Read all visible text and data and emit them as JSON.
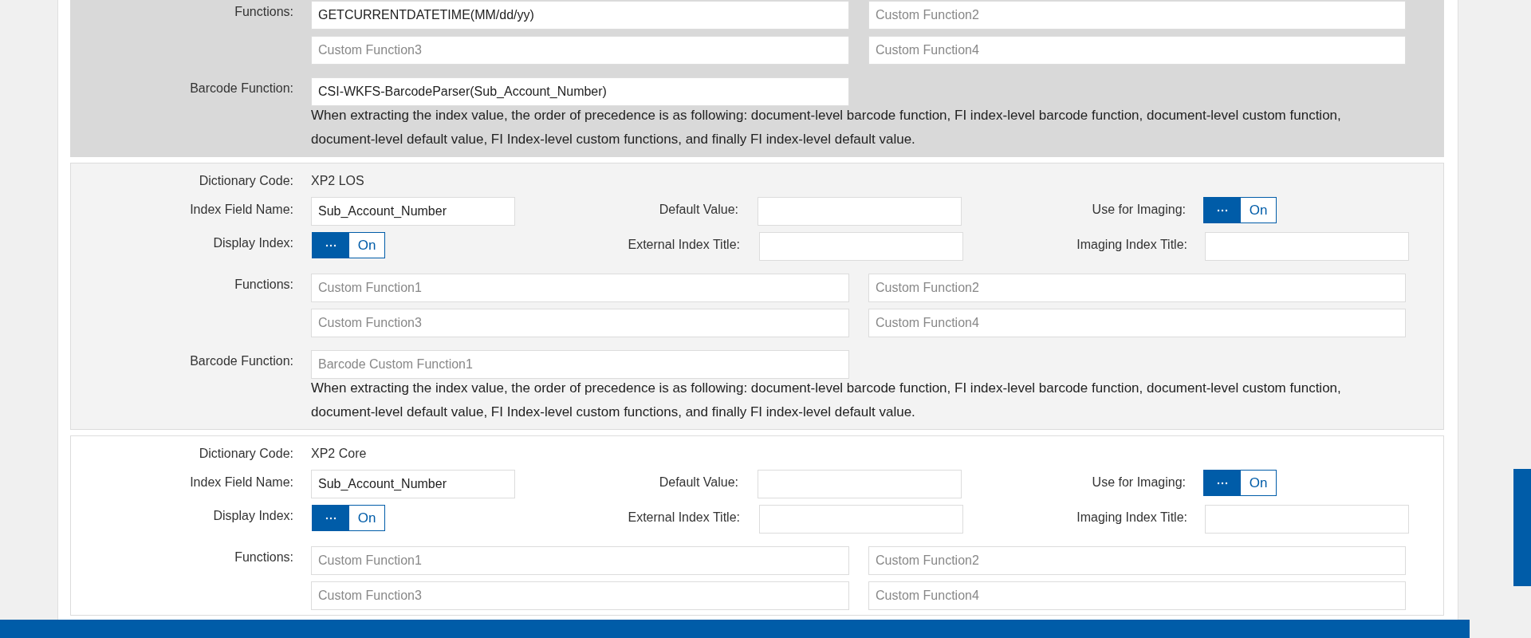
{
  "sections": [
    {
      "selected": true,
      "hovered": false,
      "functions_label": "Functions:",
      "functions": [
        {
          "value": "GETCURRENTDATETIME(MM/dd/yy)"
        },
        {
          "placeholder": "Custom Function2"
        },
        {
          "placeholder": "Custom Function3"
        },
        {
          "placeholder": "Custom Function4"
        }
      ],
      "barcode_label": "Barcode Function:",
      "barcode": {
        "value": "CSI-WKFS-BarcodeParser(Sub_Account_Number)"
      },
      "note": "When extracting the index value, the order of precedence is as following: document-level barcode function, FI index-level barcode function, document-level custom function, document-level default value, FI Index-level custom functions, and finally FI index-level default value."
    },
    {
      "selected": false,
      "hovered": true,
      "dictionary_label": "Dictionary Code:",
      "dictionary_code": "XP2 LOS",
      "index_field_label": "Index Field Name:",
      "index_field": {
        "value": "Sub_Account_Number"
      },
      "default_value_label": "Default Value:",
      "use_imaging_label": "Use for Imaging:",
      "use_imaging": {
        "on": true,
        "label": "On"
      },
      "display_index_label": "Display Index:",
      "display_index": {
        "on": true,
        "label": "On"
      },
      "external_title_label": "External Index Title:",
      "imaging_title_label": "Imaging Index Title:",
      "functions_label": "Functions:",
      "functions": [
        {
          "placeholder": "Custom Function1"
        },
        {
          "placeholder": "Custom Function2"
        },
        {
          "placeholder": "Custom Function3"
        },
        {
          "placeholder": "Custom Function4"
        }
      ],
      "barcode_label": "Barcode Function:",
      "barcode": {
        "placeholder": "Barcode Custom Function1"
      },
      "note": "When extracting the index value, the order of precedence is as following: document-level barcode function, FI index-level barcode function, document-level custom function, document-level default value, FI Index-level custom functions, and finally FI index-level default value."
    },
    {
      "selected": false,
      "hovered": false,
      "dictionary_label": "Dictionary Code:",
      "dictionary_code": "XP2 Core",
      "index_field_label": "Index Field Name:",
      "index_field": {
        "value": "Sub_Account_Number"
      },
      "default_value_label": "Default Value:",
      "use_imaging_label": "Use for Imaging:",
      "use_imaging": {
        "on": true,
        "label": "On"
      },
      "display_index_label": "Display Index:",
      "display_index": {
        "on": true,
        "label": "On"
      },
      "external_title_label": "External Index Title:",
      "imaging_title_label": "Imaging Index Title:",
      "functions_label": "Functions:",
      "functions": [
        {
          "placeholder": "Custom Function1"
        },
        {
          "placeholder": "Custom Function2"
        },
        {
          "placeholder": "Custom Function3"
        },
        {
          "placeholder": "Custom Function4"
        }
      ]
    }
  ]
}
